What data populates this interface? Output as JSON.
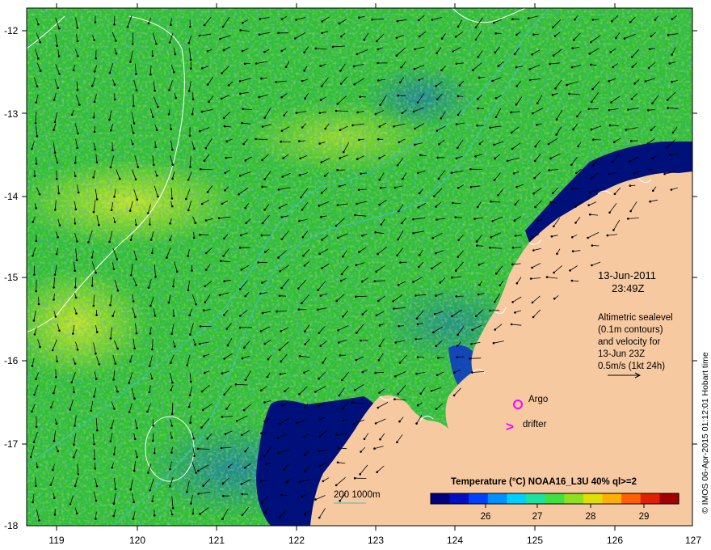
{
  "map": {
    "lon_ticks": [
      "119",
      "120",
      "121",
      "122",
      "123",
      "124",
      "125",
      "126",
      "127"
    ],
    "lat_ticks": [
      "-12",
      "-13",
      "-14",
      "-15",
      "-16",
      "-17",
      "-18"
    ]
  },
  "timestamp": {
    "date": "13-Jun-2011",
    "time": "23:49Z"
  },
  "altimetry_note": {
    "lines": [
      "Altimetric sealevel",
      "(0.1m contours)",
      "and velocity for",
      "13-Jun 23Z",
      "0.5m/s (1kt 24h)"
    ]
  },
  "legend": {
    "argo_label": "Argo",
    "drifter_label": "drifter",
    "drifter_symbol": ">",
    "depth_contours_label": "200  1000m"
  },
  "colorbar": {
    "title": "Temperature (°C) NOAA16_L3U 40% ql>=2",
    "ticks": [
      "26",
      "27",
      "28",
      "29"
    ],
    "colors": [
      "#00007f",
      "#0010c0",
      "#0040ff",
      "#0090ff",
      "#00d0ff",
      "#20e0a0",
      "#40e040",
      "#90e020",
      "#e0e000",
      "#ffb000",
      "#ff6000",
      "#e02000",
      "#a00000"
    ]
  },
  "credit": "© IMOS 06-Apr-2015 01:12:01 Hobart time",
  "colors": {
    "land": "#f7c9a1",
    "argo_marker": "#ff00ff",
    "contour": "#ffffff",
    "bathymetry": "#40c0c0",
    "ocean_green": "#2fc02f",
    "ocean_yellow": "#c8e81e",
    "ocean_blue": "#1020c0",
    "deep_blue": "#00107a"
  }
}
